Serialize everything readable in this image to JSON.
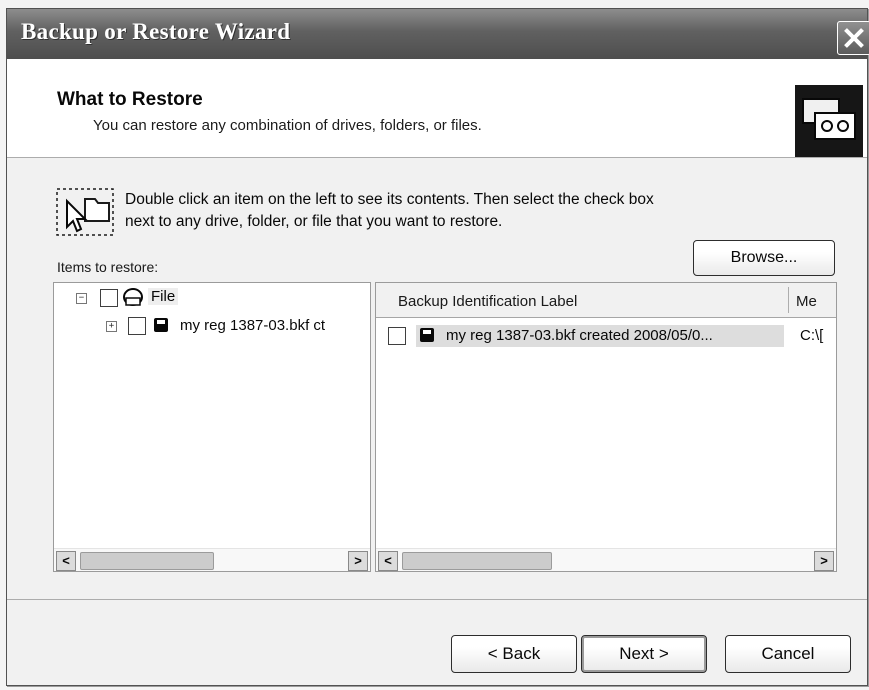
{
  "window": {
    "title": "Backup or Restore Wizard"
  },
  "header": {
    "title": "What to Restore",
    "subtitle": "You can restore any combination of drives, folders, or files."
  },
  "instructions": "Double click an item on the left to see its contents. Then select the check box next to any drive, folder, or file that you want to restore.",
  "browse_label": "Browse...",
  "items_label": "Items to restore:",
  "tree": {
    "root_label": "File",
    "child_label": "my reg 1387-03.bkf ct"
  },
  "list": {
    "columns": [
      "Backup Identification Label",
      "Me"
    ],
    "rows": [
      {
        "label": "my reg 1387-03.bkf created 2008/05/0...",
        "media": "C:\\["
      }
    ]
  },
  "buttons": {
    "back": "< Back",
    "next": "Next >",
    "cancel": "Cancel"
  }
}
